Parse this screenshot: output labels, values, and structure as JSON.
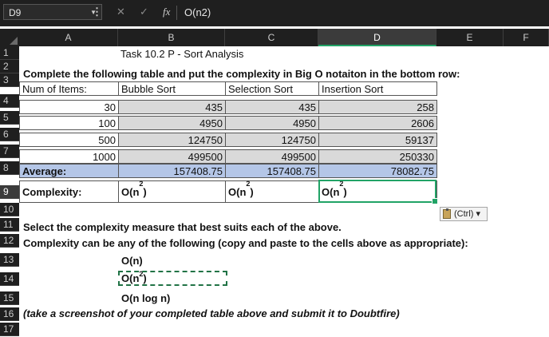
{
  "formula_bar": {
    "name_box": "D9",
    "dropdown_glyph": "▼",
    "menu_glyph": "⋮",
    "cancel_glyph": "✕",
    "enter_glyph": "✓",
    "fx_glyph": "fx",
    "formula": "O(n2)"
  },
  "columns": [
    "A",
    "B",
    "C",
    "D",
    "E",
    "F"
  ],
  "selected_column": "D",
  "rows": [
    "1",
    "2",
    "3",
    "4",
    "5",
    "6",
    "7",
    "8",
    "9",
    "10",
    "11",
    "12",
    "13",
    "14",
    "15",
    "16",
    "17"
  ],
  "selected_row": "9",
  "sheet": {
    "b1": "Task 10.2 P - Sort Analysis",
    "a2": "Complete the following table and put the complexity in Big O notaiton in the bottom row:",
    "headers": [
      "Num of Items:",
      "Bubble Sort",
      "Selection Sort",
      "Insertion Sort"
    ],
    "data_rows": [
      [
        "30",
        "435",
        "435",
        "258"
      ],
      [
        "100",
        "4950",
        "4950",
        "2606"
      ],
      [
        "500",
        "124750",
        "124750",
        "59137"
      ],
      [
        "1000",
        "499500",
        "499500",
        "250330"
      ]
    ],
    "average": [
      "Average:",
      "157408.75",
      "157408.75",
      "78082.75"
    ],
    "complexity_label": "Complexity:",
    "complexity_base": [
      "O(n",
      "O(n",
      "O(n"
    ],
    "complexity_exp": [
      "2",
      "2",
      "2"
    ],
    "complexity_close": [
      ")",
      ")",
      ")"
    ],
    "a11": "Select the complexity measure that best suits each of the above.",
    "a12": "Complexity can be any of the following (copy and paste to the cells above as appropriate):",
    "b13": "O(n)",
    "b14_base": "O(n",
    "b14_exp": "2",
    "b14_close": ")",
    "b15": "O(n log n)",
    "a16": "(take a screenshot of your completed table above and submit it to Doubtfire)"
  },
  "paste_options": {
    "label": "(Ctrl) ▾"
  },
  "colors": {
    "accent": "#21a366",
    "header_bg": "#1f1f1f",
    "row_gray": "#d9d9d9",
    "row_blue": "#b4c6e7"
  }
}
